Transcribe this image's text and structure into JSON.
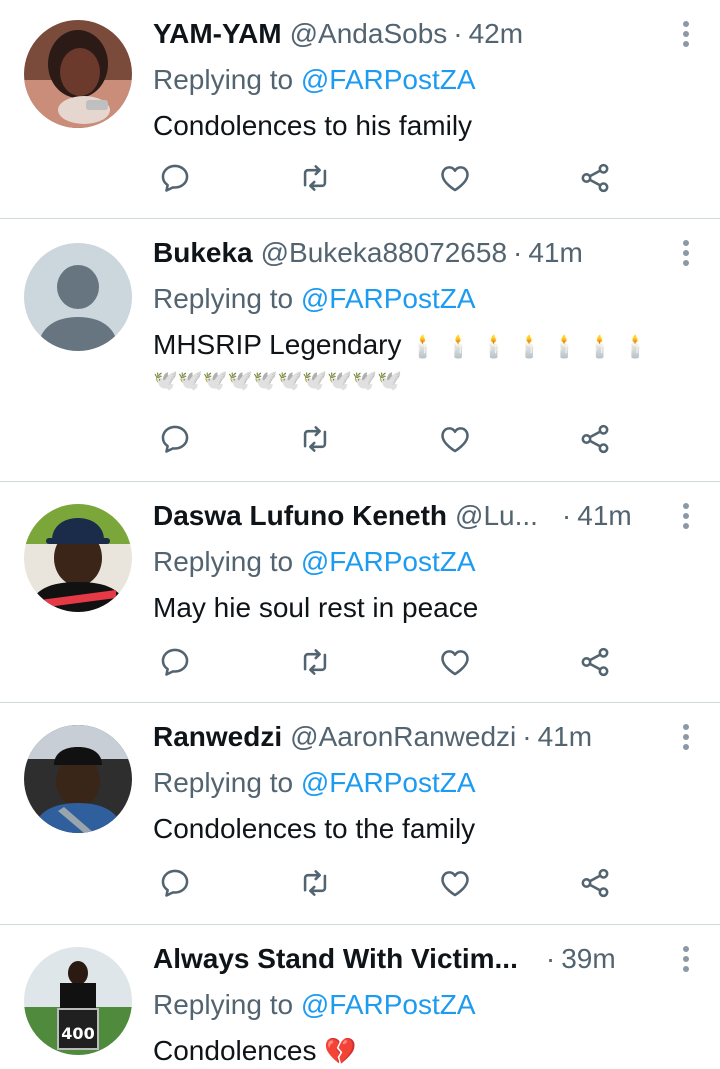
{
  "tweets": [
    {
      "name": "YAM-YAM",
      "handle": "@AndaSobs",
      "sep": "·",
      "time": "42m",
      "replying_prefix": "Replying to",
      "replying_to": "@FARPostZA",
      "text": "Condolences to his family",
      "avatar": "woman-portrait"
    },
    {
      "name": "Bukeka",
      "handle": "@Bukeka88072658",
      "sep": "·",
      "time": "41m",
      "replying_prefix": "Replying to",
      "replying_to": "@FARPostZA",
      "text": "MHSRIP Legendary",
      "emoji_line1": "🕯️🕯️🕯️🕯️🕯️🕯️🕯️",
      "emoji_line2": "🕊️🕊️🕊️🕊️🕊️🕊️🕊️🕊️🕊️🕊️",
      "avatar": "default-profile"
    },
    {
      "name": "Daswa Lufuno Keneth",
      "handle": "@Lu...",
      "sep": "·",
      "time": "41m",
      "replying_prefix": "Replying to",
      "replying_to": "@FARPostZA",
      "text": "May hie soul rest in peace",
      "avatar": "man-cap-portrait"
    },
    {
      "name": "Ranwedzi",
      "handle": "@AaronRanwedzi",
      "sep": "·",
      "time": "41m",
      "replying_prefix": "Replying to",
      "replying_to": "@FARPostZA",
      "text": "Condolences to the family",
      "avatar": "man-car-portrait"
    },
    {
      "name": "Always Stand With Victim...",
      "handle": "",
      "sep": "·",
      "time": "39m",
      "replying_prefix": "Replying to",
      "replying_to": "@FARPostZA",
      "text": "Condolences",
      "text_emoji": "💔",
      "avatar": "player-jersey-400"
    }
  ],
  "icons": [
    "reply-icon",
    "retweet-icon",
    "like-icon",
    "share-icon",
    "more-icon"
  ],
  "colors": {
    "link": "#1d9bf0",
    "secondary": "#536471",
    "primary": "#0f1419",
    "divider": "#cfd9de"
  }
}
